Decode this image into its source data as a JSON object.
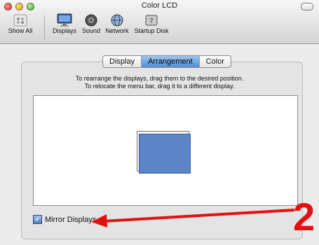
{
  "window": {
    "title": "Color LCD"
  },
  "toolbar": {
    "items": [
      {
        "label": "Show All",
        "icon": "grid-icon"
      },
      {
        "label": "Displays",
        "icon": "display-icon"
      },
      {
        "label": "Sound",
        "icon": "speaker-icon"
      },
      {
        "label": "Network",
        "icon": "globe-icon"
      },
      {
        "label": "Startup Disk",
        "icon": "disk-icon"
      }
    ]
  },
  "tabs": [
    {
      "label": "Display",
      "active": false
    },
    {
      "label": "Arrangement",
      "active": true
    },
    {
      "label": "Color",
      "active": false
    }
  ],
  "instructions": {
    "line1": "To rearrange the displays, drag them to the desired position.",
    "line2": "To relocate the menu bar, drag it to a different display."
  },
  "mirror": {
    "label": "Mirror Displays",
    "checked": true
  },
  "annotation": {
    "number": "2",
    "color": "#e01212"
  },
  "colors": {
    "display": "#5b85c7",
    "accent_tab": "#4f8fd6"
  }
}
